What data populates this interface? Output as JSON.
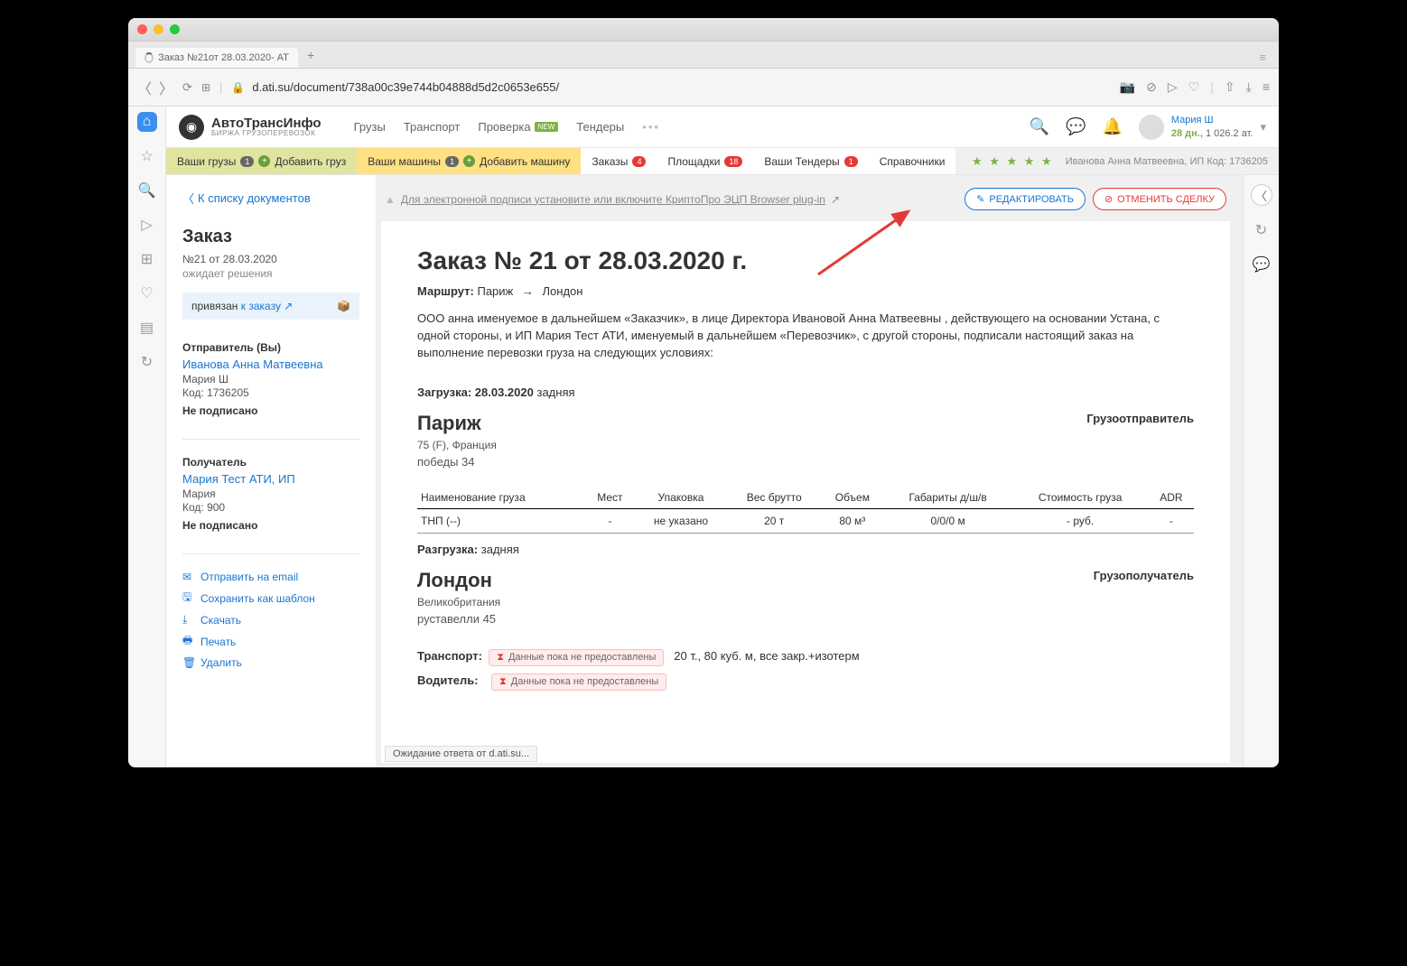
{
  "browser": {
    "tab_title": "Заказ №21от 28.03.2020- АТ",
    "url": "d.ati.su/document/738a00c39e744b04888d5d2c0653e655/",
    "status": "Ожидание ответа от d.ati.su..."
  },
  "logo": {
    "title": "АвтоТрансИнфо",
    "sub": "БИРЖА ГРУЗОПЕРЕВОЗОК"
  },
  "topnav": {
    "cargo": "Грузы",
    "transport": "Транспорт",
    "check": "Проверка",
    "new": "NEW",
    "tenders": "Тендеры"
  },
  "user": {
    "name": "Мария Ш",
    "days": "28 дн.,",
    "rating": "1 026.2 ат."
  },
  "subnav": {
    "your_cargo": "Ваши грузы",
    "cargo_n": "1",
    "add_cargo": "Добавить груз",
    "your_trucks": "Ваши машины",
    "trucks_n": "1",
    "add_truck": "Добавить машину",
    "orders": "Заказы",
    "orders_n": "4",
    "sites": "Площадки",
    "sites_n": "18",
    "your_tenders": "Ваши Тендеры",
    "tenders_n": "1",
    "refs": "Справочники",
    "company": "Иванова Анна Матвеевна, ИП  Код: 1736205"
  },
  "sidebar": {
    "back": "К списку документов",
    "title": "Заказ",
    "num": "№21 от 28.03.2020",
    "status": "ожидает решения",
    "linked_pre": "привязан",
    "linked_link": "к заказу",
    "sender_label": "Отправитель (Вы)",
    "sender_name": "Иванова Анна Матвеевна",
    "sender_person": "Мария Ш",
    "sender_code": "Код: 1736205",
    "not_signed": "Не подписано",
    "recipient_label": "Получатель",
    "recipient_name": "Мария Тест АТИ, ИП",
    "recipient_person": "Мария",
    "recipient_code": "Код: 900",
    "actions": {
      "email": "Отправить на email",
      "template": "Сохранить как шаблон",
      "download": "Скачать",
      "print": "Печать",
      "delete": "Удалить"
    }
  },
  "plugin": {
    "msg": "Для электронной подписи установите или включите КриптоПро ЭЦП Browser plug-in",
    "edit": "РЕДАКТИРОВАТЬ",
    "cancel": "ОТМЕНИТЬ СДЕЛКУ"
  },
  "doc": {
    "h1": "Заказ №  21 от 28.03.2020 г.",
    "route_label": "Маршрут:",
    "from": "Париж",
    "to": "Лондон",
    "para": "ООО анна именуемое в дальнейшем «Заказчик», в лице Директора Ивановой Анна Матвеевны , действующего на основании Устана, с одной стороны, и ИП Мария Тест АТИ, именуемый в дальнейшем «Перевозчик», с другой стороны, подписали настоящий заказ на выполнение перевозки груза на следующих условиях:",
    "load_label": "Загрузка:",
    "load_date": "28.03.2020",
    "load_type": "задняя",
    "shipper": "Грузоотправитель",
    "city1": "Париж",
    "city1_sub": "75 (F), Франция",
    "addr1": "победы 34",
    "table": {
      "h_name": "Наименование груза",
      "h_places": "Мест",
      "h_pack": "Упаковка",
      "h_weight": "Вес брутто",
      "h_vol": "Объем",
      "h_dim": "Габариты д/ш/в",
      "h_cost": "Стоимость груза",
      "h_adr": "ADR",
      "r_name": "ТНП (--)",
      "r_places": "-",
      "r_pack": "не указано",
      "r_weight": "20 т",
      "r_vol": "80 м³",
      "r_dim": "0/0/0 м",
      "r_cost": "- руб.",
      "r_adr": "-"
    },
    "unload_label": "Разгрузка:",
    "unload_type": "задняя",
    "consignee": "Грузополучатель",
    "city2": "Лондон",
    "city2_sub": "Великобритания",
    "addr2": "руставелли 45",
    "transport_label": "Транспорт:",
    "pending": "Данные пока не предоставлены",
    "transport_spec": "20 т., 80 куб. м, все закр.+изотерм",
    "driver_label": "Водитель:"
  }
}
